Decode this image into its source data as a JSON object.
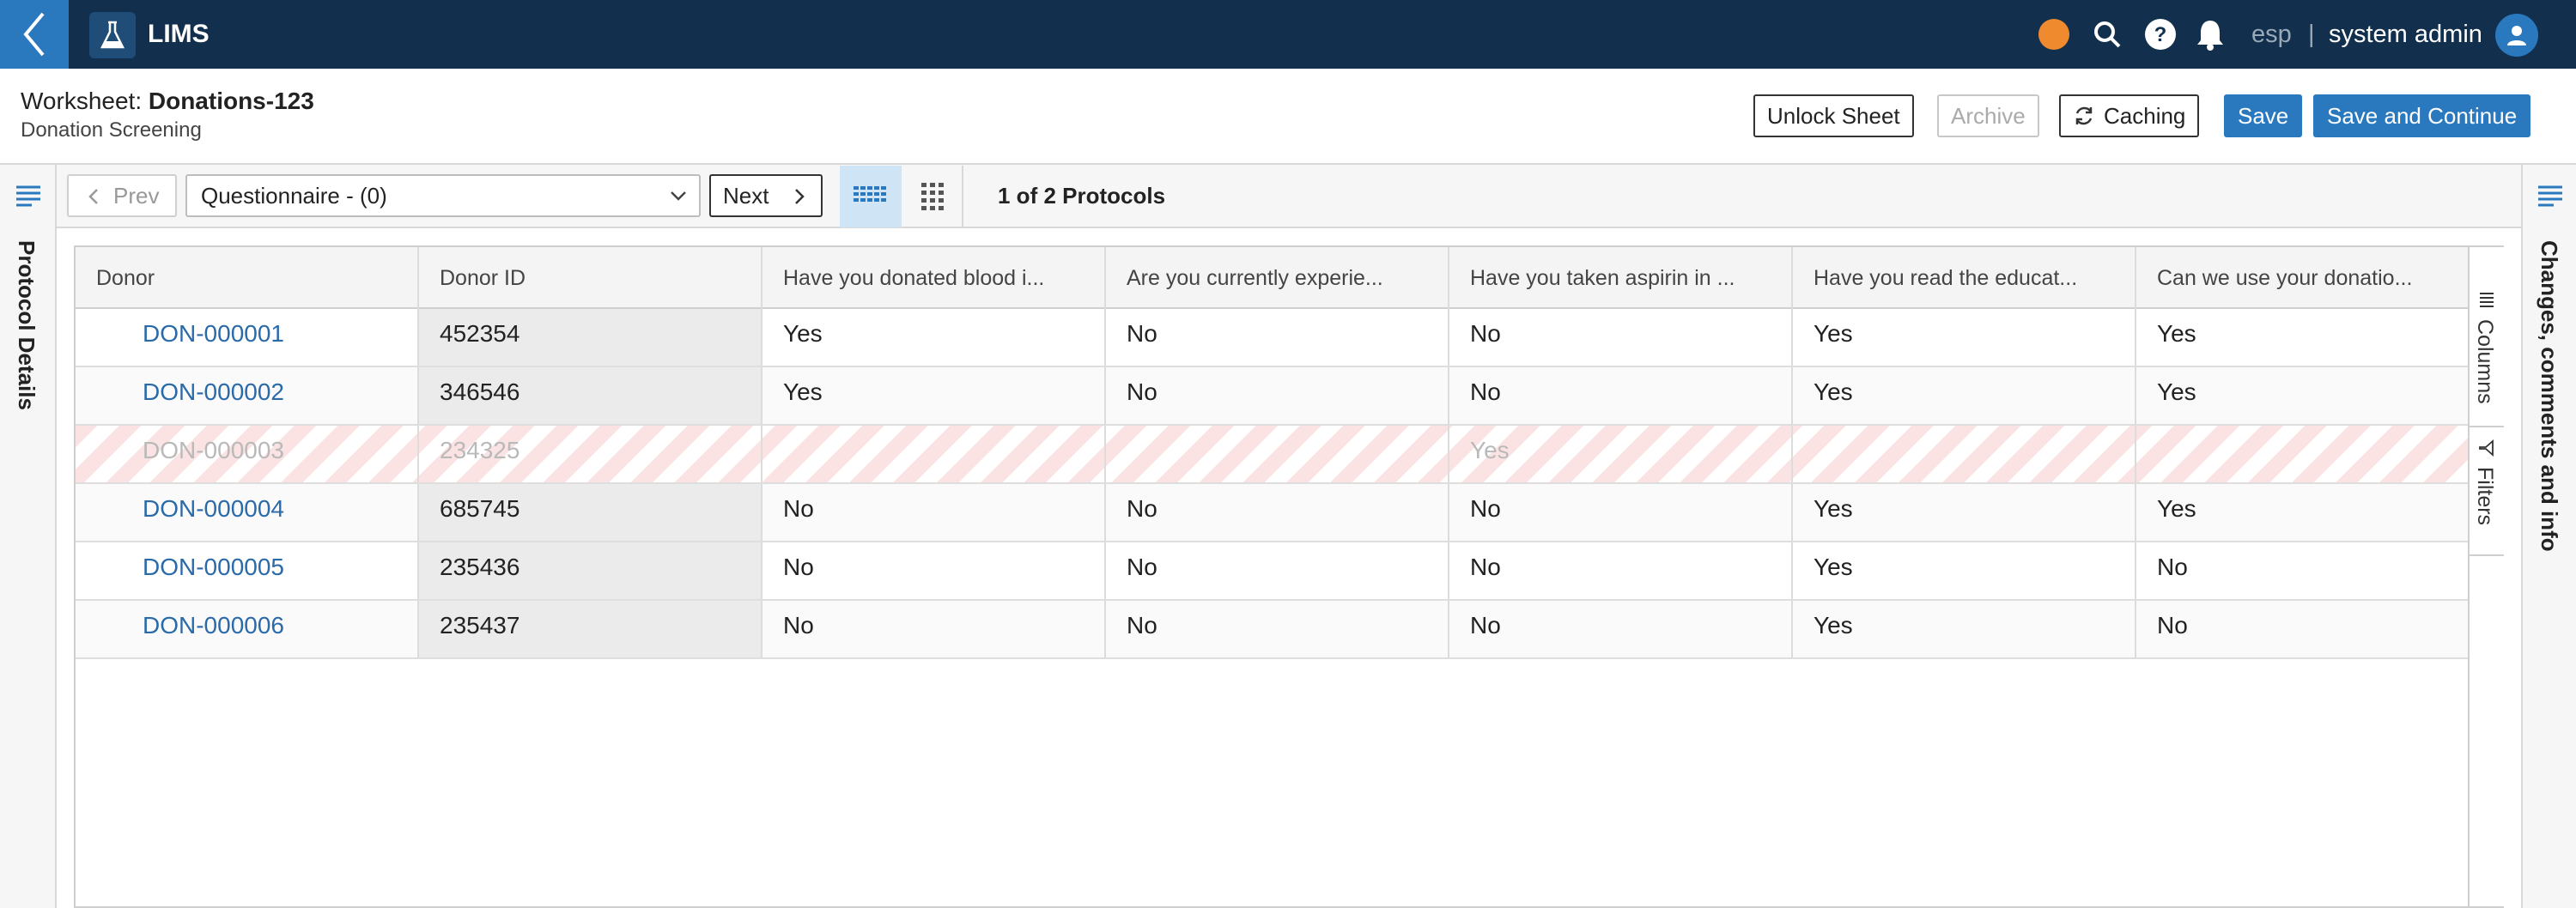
{
  "app": {
    "name": "LIMS",
    "language": "esp",
    "language_separator": "|",
    "user": "system admin"
  },
  "icons": {
    "back": "chevron-left-icon",
    "app": "flask-icon",
    "status": "status-dot",
    "search": "search-icon",
    "help": "help-icon",
    "notifications": "bell-icon",
    "avatar": "user-icon"
  },
  "colors": {
    "navbar": "#12304d",
    "accent": "#2a79bf",
    "status_dot": "#f08a2e",
    "link": "#2a6aa8",
    "excluded_row_stripe": "#fbe3e3"
  },
  "worksheet": {
    "label": "Worksheet: ",
    "name": "Donations-123",
    "subtitle": "Donation Screening"
  },
  "actions": {
    "unlock": "Unlock Sheet",
    "archive": "Archive",
    "caching": "Caching",
    "save": "Save",
    "save_continue": "Save and Continue"
  },
  "toolbar": {
    "prev": "Prev",
    "protocol_select": "Questionnaire - (0)",
    "next": "Next",
    "protocol_count": "1 of 2 Protocols",
    "active_view": "grid-view"
  },
  "left_panel": {
    "label": "Protocol Details"
  },
  "right_panel": {
    "label": "Changes, comments and info"
  },
  "side_tabs": {
    "columns": "Columns",
    "filters": "Filters"
  },
  "table": {
    "columns": [
      "Donor",
      "Donor ID",
      "Have you donated blood i...",
      "Are you currently experie...",
      "Have you taken aspirin in ...",
      "Have you read the educat...",
      "Can we use your donatio..."
    ],
    "rows": [
      {
        "donor": "DON-000001",
        "donor_id": "452354",
        "q1": "Yes",
        "q2": "No",
        "q3": "No",
        "q4": "Yes",
        "q5": "Yes",
        "excluded": false
      },
      {
        "donor": "DON-000002",
        "donor_id": "346546",
        "q1": "Yes",
        "q2": "No",
        "q3": "No",
        "q4": "Yes",
        "q5": "Yes",
        "excluded": false
      },
      {
        "donor": "DON-000003",
        "donor_id": "234325",
        "q1": "",
        "q2": "",
        "q3": "Yes",
        "q4": "",
        "q5": "",
        "excluded": true
      },
      {
        "donor": "DON-000004",
        "donor_id": "685745",
        "q1": "No",
        "q2": "No",
        "q3": "No",
        "q4": "Yes",
        "q5": "Yes",
        "excluded": false
      },
      {
        "donor": "DON-000005",
        "donor_id": "235436",
        "q1": "No",
        "q2": "No",
        "q3": "No",
        "q4": "Yes",
        "q5": "No",
        "excluded": false
      },
      {
        "donor": "DON-000006",
        "donor_id": "235437",
        "q1": "No",
        "q2": "No",
        "q3": "No",
        "q4": "Yes",
        "q5": "No",
        "excluded": false
      }
    ]
  }
}
